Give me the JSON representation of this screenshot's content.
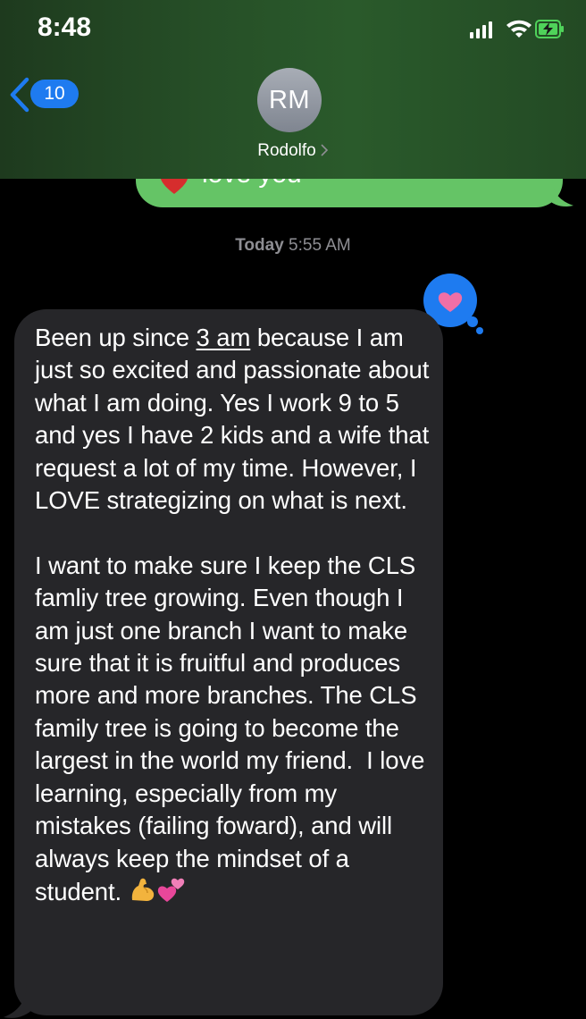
{
  "status_bar": {
    "time": "8:48",
    "icons": [
      "signal-icon",
      "wifi-icon",
      "battery-charging-icon"
    ]
  },
  "header": {
    "back_badge_count": "10",
    "avatar_initials": "RM",
    "contact_name": "Rodolfo"
  },
  "messages": {
    "sent_partial_text": "love you",
    "timestamp_day": "Today",
    "timestamp_time": "5:55 AM",
    "reaction": "heart",
    "received": {
      "intro": "Been up since ",
      "link": "3 am",
      "body": " because I am just so excited and passionate about what I am doing. Yes I work 9 to 5 and yes I have 2 kids and a wife that request a lot of my time. However, I LOVE strategizing on what is next.\n\nI want to make sure I keep the CLS famliy tree growing. Even though I am just one branch I want to make sure that it is fruitful and produces more and more branches. The CLS family tree is going to become the largest in the world my friend.  I love learning, especially from my mistakes (failing foward), and will always keep the mindset of a student. "
    }
  },
  "colors": {
    "sent_bubble": "#65c466",
    "received_bubble": "#262629",
    "accent_blue": "#1e7bf0",
    "tapback_heart": "#f06fa6"
  }
}
